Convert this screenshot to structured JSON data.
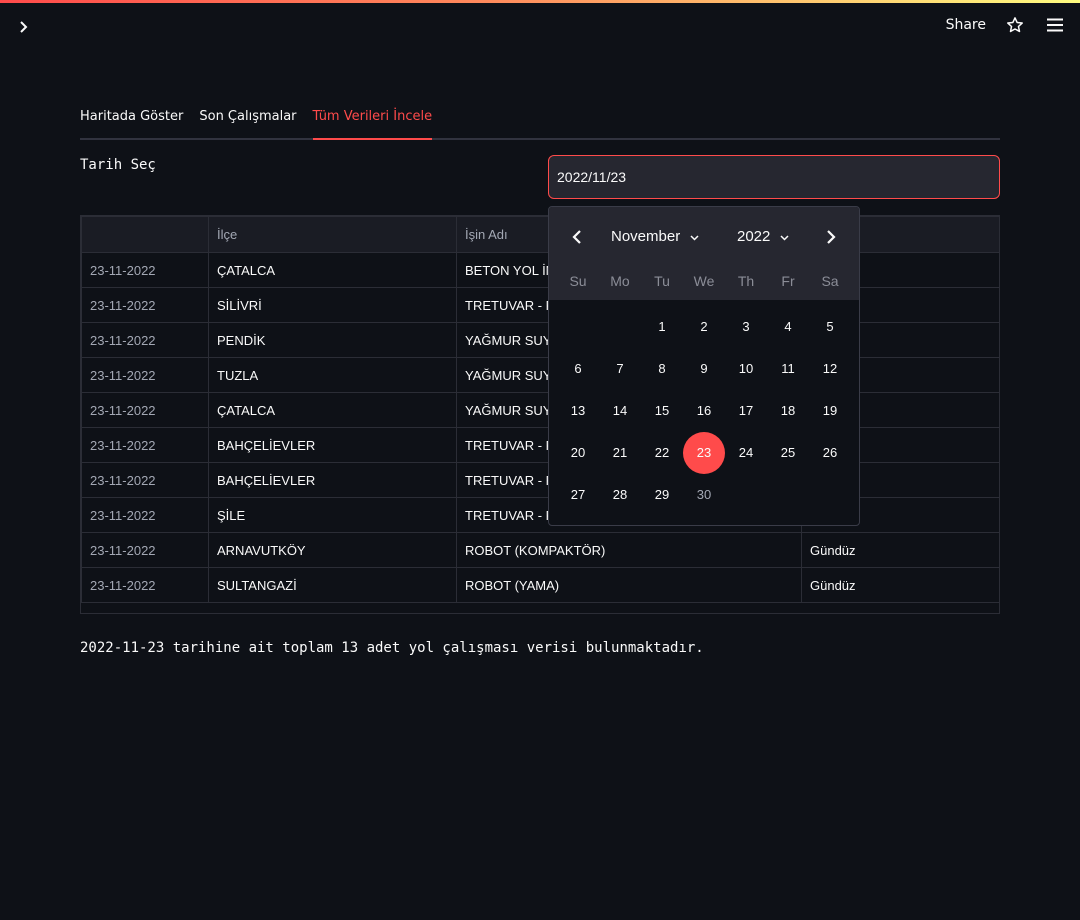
{
  "header": {
    "share_label": "Share",
    "icons": [
      "chevron-right-icon",
      "star-icon",
      "hamburger-menu-icon"
    ]
  },
  "tabs": [
    {
      "label": "Haritada Göster",
      "active": false
    },
    {
      "label": "Son Çalışmalar",
      "active": false
    },
    {
      "label": "Tüm Verileri İncele",
      "active": true
    }
  ],
  "date_picker": {
    "label": "Tarih Seç",
    "value": "2022/11/23"
  },
  "calendar": {
    "month": "November",
    "year": "2022",
    "weekdays": [
      "Su",
      "Mo",
      "Tu",
      "We",
      "Th",
      "Fr",
      "Sa"
    ],
    "days": [
      "1",
      "2",
      "3",
      "4",
      "5",
      "6",
      "7",
      "8",
      "9",
      "10",
      "11",
      "12",
      "13",
      "14",
      "15",
      "16",
      "17",
      "18",
      "19",
      "20",
      "21",
      "22",
      "23",
      "24",
      "25",
      "26",
      "27",
      "28",
      "29",
      "30"
    ],
    "selected_day": "23",
    "first_weekday_index": 2
  },
  "table": {
    "columns": [
      "",
      "İlçe",
      "İşin Adı",
      ""
    ],
    "rows": [
      [
        "23-11-2022",
        "ÇATALCA",
        "BETON YOL İMA",
        ""
      ],
      [
        "23-11-2022",
        "SİLİVRİ",
        "TRETUVAR - PA",
        ""
      ],
      [
        "23-11-2022",
        "PENDİK",
        "YAĞMUR SUYU",
        ""
      ],
      [
        "23-11-2022",
        "TUZLA",
        "YAĞMUR SUYU",
        ""
      ],
      [
        "23-11-2022",
        "ÇATALCA",
        "YAĞMUR SUYU",
        ""
      ],
      [
        "23-11-2022",
        "BAHÇELİEVLER",
        "TRETUVAR - PA",
        ""
      ],
      [
        "23-11-2022",
        "BAHÇELİEVLER",
        "TRETUVAR - PA",
        ""
      ],
      [
        "23-11-2022",
        "ŞİLE",
        "TRETUVAR - PA",
        ""
      ],
      [
        "23-11-2022",
        "ARNAVUTKÖY",
        "ROBOT (KOMPAKTÖR)",
        "Gündüz"
      ],
      [
        "23-11-2022",
        "SULTANGAZİ",
        "ROBOT (YAMA)",
        "Gündüz"
      ]
    ]
  },
  "summary": "2022-11-23 tarihine ait toplam 13 adet yol çalışması verisi bulunmaktadır.",
  "colors": {
    "accent": "#ff4b4b",
    "background": "#0e1117",
    "input_bg": "#262730"
  }
}
